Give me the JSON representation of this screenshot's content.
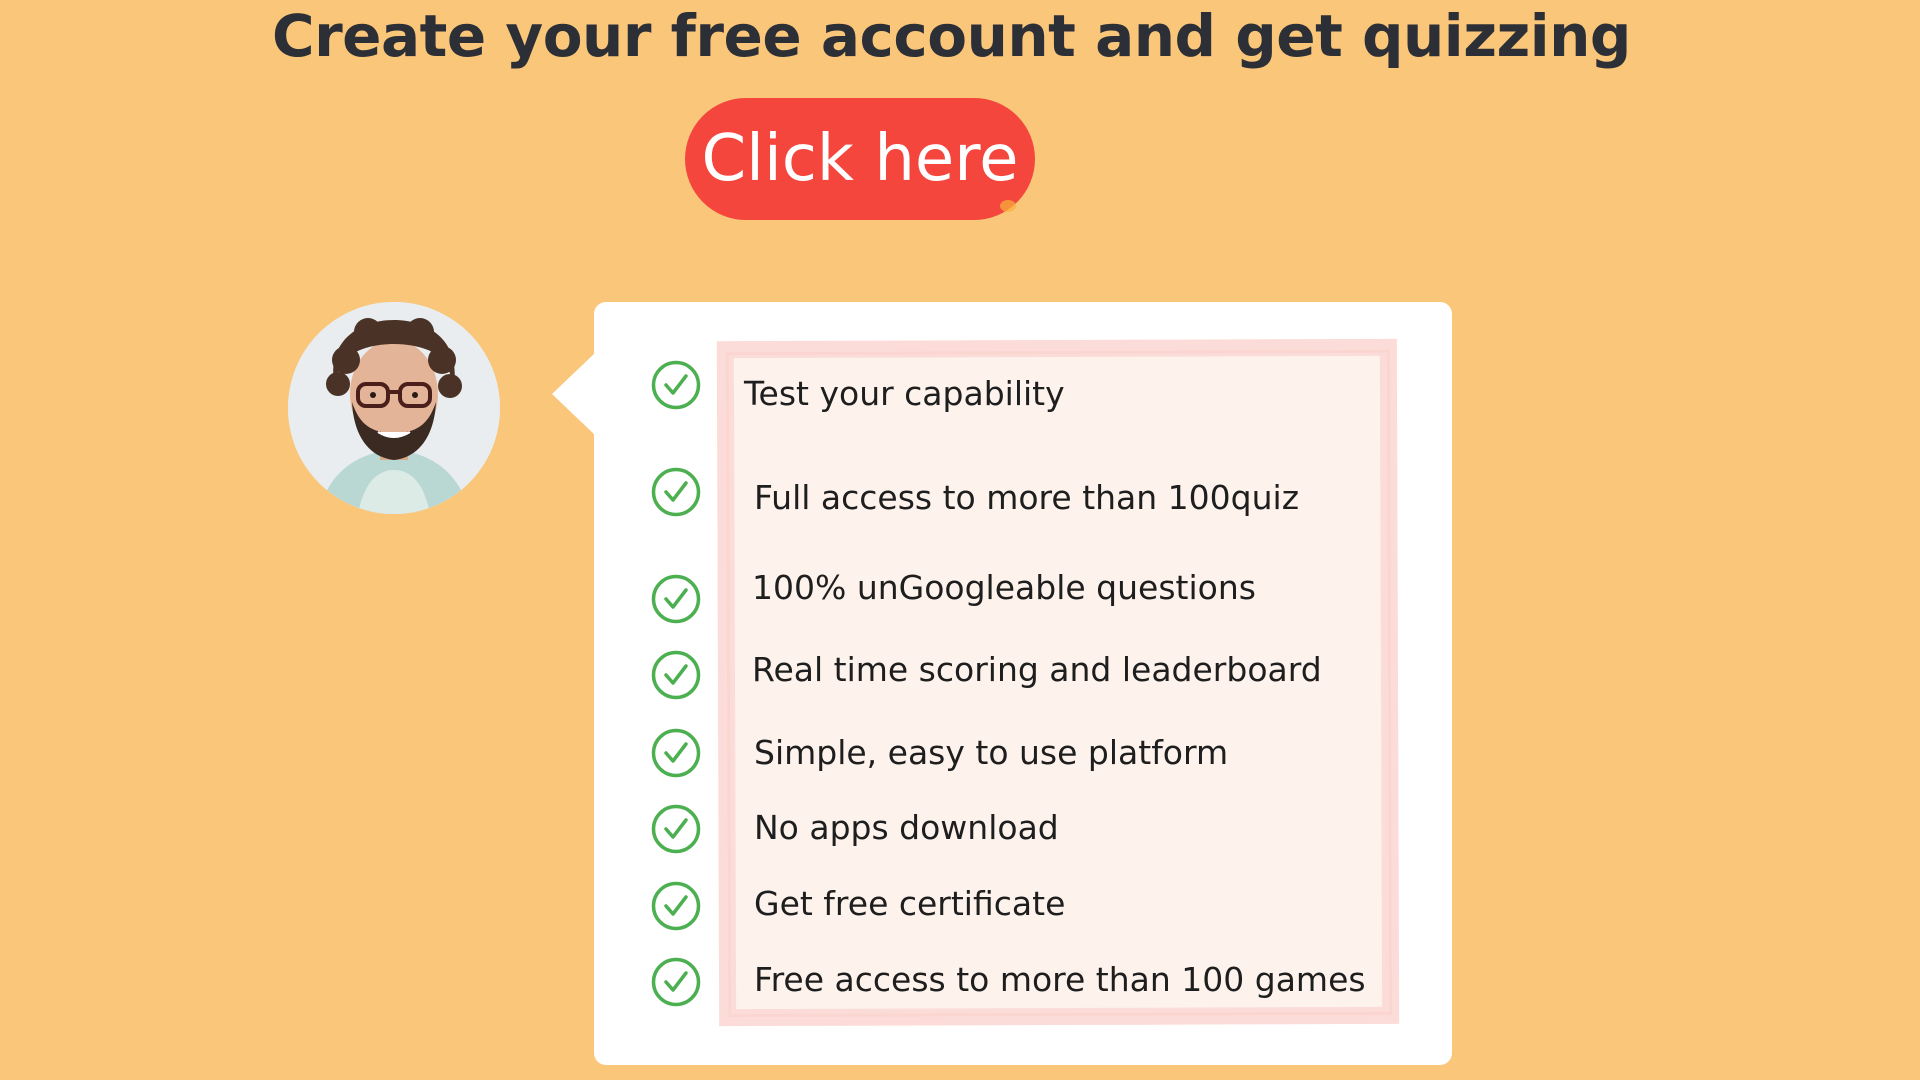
{
  "headline": "Create your free account and get quizzing",
  "cta": {
    "label": "Click here"
  },
  "features": [
    "Test your capability",
    "Full access to more than 100quiz",
    "100% unGoogleable questions",
    "Real time scoring and leaderboard",
    "Simple, easy to use platform",
    "No apps download",
    "Get free certificate",
    "Free access to more than 100 games"
  ],
  "icons": {
    "feature": "check-circle-icon"
  },
  "colors": {
    "background": "#FAC67A",
    "cta": "#F4463C",
    "check": "#4CAF50",
    "headline": "#2D2F36"
  }
}
